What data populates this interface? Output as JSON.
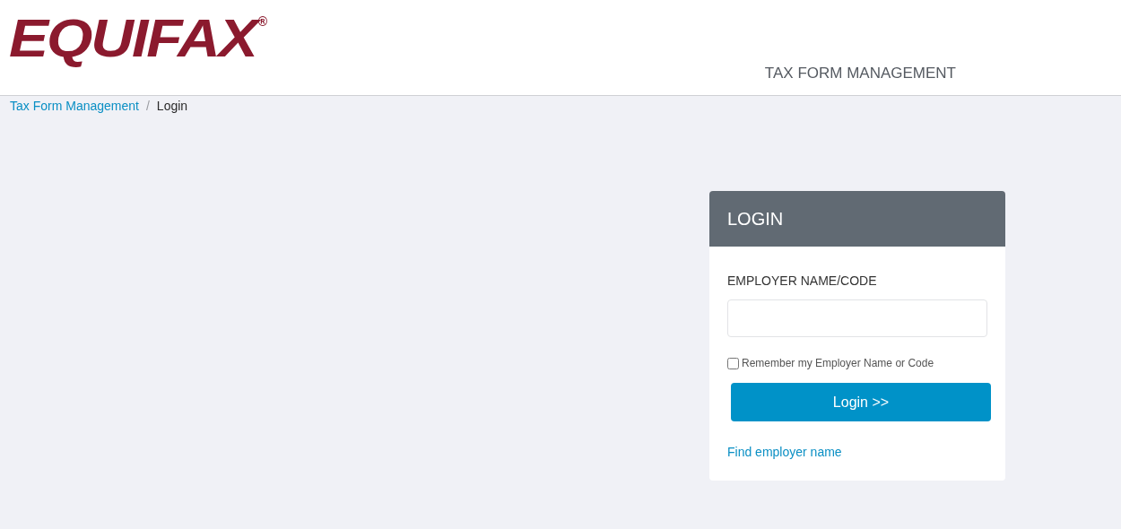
{
  "header": {
    "logo": {
      "text": "EQUIFAX",
      "mark": "®"
    },
    "title": "TAX FORM MANAGEMENT"
  },
  "breadcrumb_separator": "/",
  "breadcrumb": [
    {
      "label": "Tax Form Management",
      "kind": "link"
    },
    {
      "label": "Login",
      "kind": "current"
    }
  ],
  "login": {
    "title": "LOGIN",
    "field": {
      "label": "EMPLOYER NAME/CODE"
    },
    "remember": {
      "label": "Remember my Employer Name or Code",
      "checked": false
    },
    "button": "Login >>",
    "link": "Find employer name"
  }
}
